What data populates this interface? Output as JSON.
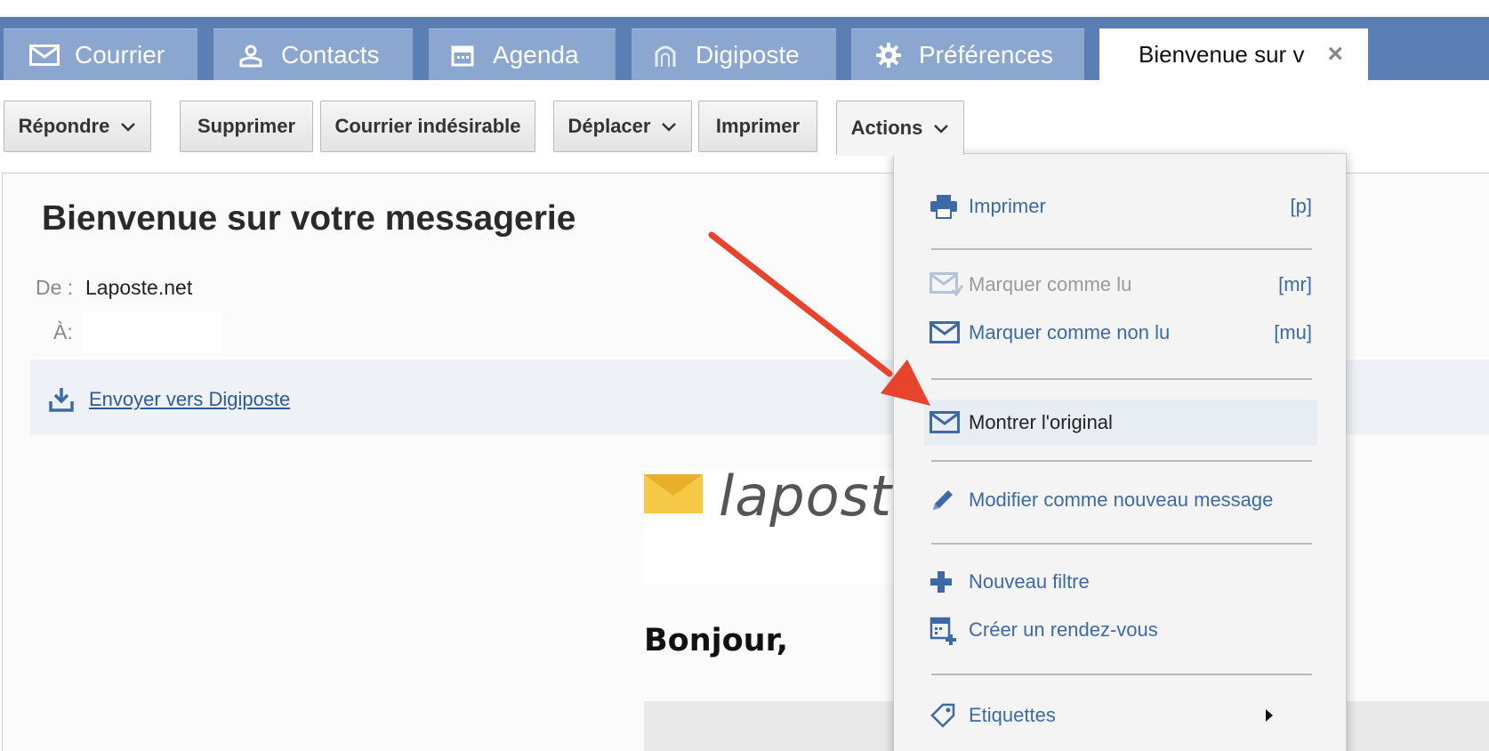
{
  "tabs": [
    {
      "label": "Courrier",
      "icon": "envelope-icon"
    },
    {
      "label": "Contacts",
      "icon": "contacts-icon"
    },
    {
      "label": "Agenda",
      "icon": "calendar-icon"
    },
    {
      "label": "Digiposte",
      "icon": "digiposte-icon"
    },
    {
      "label": "Préférences",
      "icon": "gear-icon"
    },
    {
      "label": "Bienvenue sur v",
      "icon": "close-icon",
      "active": true
    }
  ],
  "toolbar": {
    "reply": "Répondre",
    "delete": "Supprimer",
    "spam": "Courrier indésirable",
    "move": "Déplacer",
    "print": "Imprimer",
    "actions": "Actions"
  },
  "message": {
    "subject": "Bienvenue sur votre messagerie",
    "from_label": "De :",
    "from_value": "Laposte.net",
    "to_label": "À:",
    "digiposte_link": "Envoyer vers Digiposte",
    "logo_text": "laposte",
    "greeting": "Bonjour,"
  },
  "actions_menu": {
    "items": [
      {
        "label": "Imprimer",
        "shortcut": "[p]",
        "icon": "printer-icon",
        "state": "normal"
      },
      {
        "label": "Marquer comme lu",
        "shortcut": "[mr]",
        "icon": "envelope-read-icon",
        "state": "disabled"
      },
      {
        "label": "Marquer comme non lu",
        "shortcut": "[mu]",
        "icon": "envelope-icon",
        "state": "normal"
      },
      {
        "label": "Montrer l'original",
        "shortcut": "",
        "icon": "envelope-icon",
        "state": "highlighted"
      },
      {
        "label": "Modifier comme nouveau message",
        "shortcut": "",
        "icon": "pencil-icon",
        "state": "normal"
      },
      {
        "label": "Nouveau filtre",
        "shortcut": "",
        "icon": "plus-icon",
        "state": "normal"
      },
      {
        "label": "Créer un rendez-vous",
        "shortcut": "",
        "icon": "calendar-add-icon",
        "state": "normal"
      },
      {
        "label": "Etiquettes",
        "shortcut": "",
        "icon": "tag-icon",
        "state": "submenu"
      }
    ]
  },
  "colors": {
    "tab_bar": "#5b7fb5",
    "tab": "#8ba7d0",
    "menu_link": "#3b6aa6",
    "annotation_arrow": "#e8432d",
    "logo_yellow": "#f7c948"
  }
}
